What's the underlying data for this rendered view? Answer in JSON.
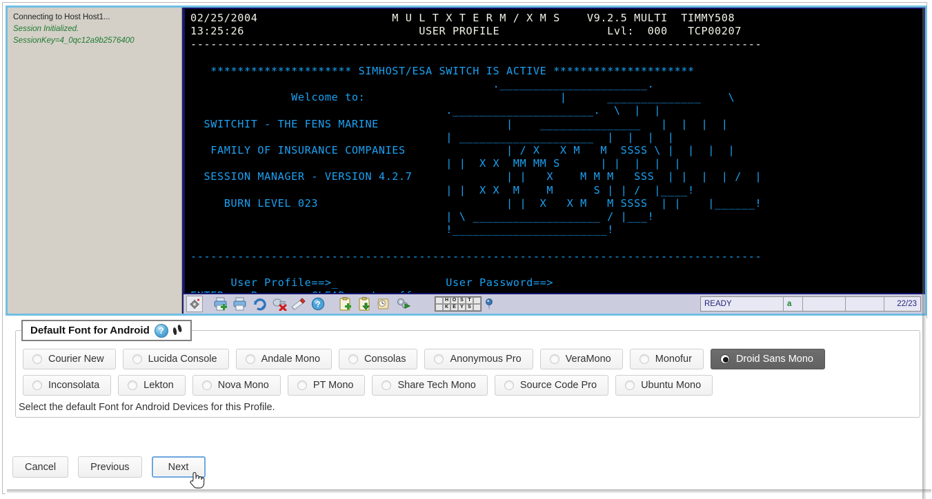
{
  "connection_pane": {
    "line1": "Connecting to Host Host1...",
    "line2": "Session Initialized.",
    "line3": "SessionKey=4_0qc12a9b2576400"
  },
  "terminal": {
    "header": {
      "date": "02/25/2004",
      "time": "13:25:26",
      "title": "M U L T X T E R M / X M S",
      "subtitle": "USER PROFILE",
      "version": "V9.2.5 MULTI",
      "terminal_id": "TIMMY508",
      "level_label": "Lvl:",
      "level_value": "000",
      "session_id": "TCP00207"
    },
    "banner": "********************* SIMHOST/ESA SWITCH IS ACTIVE *********************",
    "welcome": "Welcome to:",
    "company_line1": "SWITCHIT - THE FENS MARINE",
    "company_line2": "FAMILY OF INSURANCE COMPANIES",
    "version_line": "SESSION MANAGER - VERSION 4.2.7",
    "burn_level": "BURN LEVEL 023",
    "prompt_user_profile": "User Profile==>",
    "prompt_user_password": "User Password==>",
    "prompt_keys": "ENTER==> Process, CLEAR==> Logoff",
    "screen_text": "02/25/2004                  M U L T X T E R M / X M S     V9.2.5 MULTI      TIMMY508\n13:25:26                          USER PROFILE                 Lvl:  000  TCP00207\n- - - - - - - - - - - - - - - - - - - - - - - - - - - - - - - - - - - - - - - - - -",
    "ascii_art": [
      "                                      .______________________.",
      "                                      |      ______________    \\",
      "                        ._______________.     ____________ .  \\  |  |",
      "                        |      ________________________   |  |  |  |",
      "      .__________________________.  \\       |  |  |  |  |",
      "      |  ______________________  |  |  |  |  |",
      "      | / X    X M    M   SSSS \\ |  |  |  |  |",
      "      | |  X X   MM MM  S       | |  |  |  |  |",
      "      | |   X     M M M   SSS   | |  |  | /   |",
      "      | |  X X   M    M       S | | /  |____! |",
      "      | |  X   X M    M SSSS    | |    |______!",
      "      | \\ ______________________ / |___!",
      "      !_________________________!"
    ]
  },
  "toolbar": {
    "icons": [
      "settings-icon",
      "printer-add-icon",
      "printer-remove-icon",
      "refresh-icon",
      "disconnect-icon",
      "edit-icon",
      "help-icon",
      "clipboard-add-icon",
      "clipboard-paste-icon",
      "macro-icon",
      "run-macro-icon"
    ],
    "host_keys_label_row1": [
      "H",
      "O",
      "S",
      "T"
    ],
    "host_keys_label_row2": [
      "K",
      "E",
      "Y",
      "S"
    ]
  },
  "status_bar": {
    "state": "READY",
    "indicator": "a",
    "blank1": "",
    "blank2": "",
    "position": "22/23"
  },
  "dialog": {
    "title": "Default Font for Android",
    "hint": "Select the default Font for Android Devices for this Profile.",
    "font_rows": [
      [
        {
          "label": "Courier New",
          "selected": false
        },
        {
          "label": "Lucida Console",
          "selected": false
        },
        {
          "label": "Andale Mono",
          "selected": false
        },
        {
          "label": "Consolas",
          "selected": false
        },
        {
          "label": "Anonymous Pro",
          "selected": false
        },
        {
          "label": "VeraMono",
          "selected": false
        },
        {
          "label": "Monofur",
          "selected": false
        },
        {
          "label": "Droid Sans Mono",
          "selected": true
        }
      ],
      [
        {
          "label": "Inconsolata",
          "selected": false
        },
        {
          "label": "Lekton",
          "selected": false
        },
        {
          "label": "Nova Mono",
          "selected": false
        },
        {
          "label": "PT Mono",
          "selected": false
        },
        {
          "label": "Share Tech Mono",
          "selected": false
        },
        {
          "label": "Source Code Pro",
          "selected": false
        },
        {
          "label": "Ubuntu Mono",
          "selected": false
        }
      ]
    ],
    "buttons": {
      "cancel": "Cancel",
      "previous": "Previous",
      "next": "Next"
    }
  },
  "colors": {
    "terminal_bg": "#000000",
    "terminal_cyan": "#1ba1f2",
    "terminal_header_text": "#f2f2e8",
    "panel_border": "#6fbfe3",
    "selected_radio_bg": "#6e6e6e",
    "status_indicator": "#17852b",
    "focus_ring": "#6ca6dd"
  }
}
